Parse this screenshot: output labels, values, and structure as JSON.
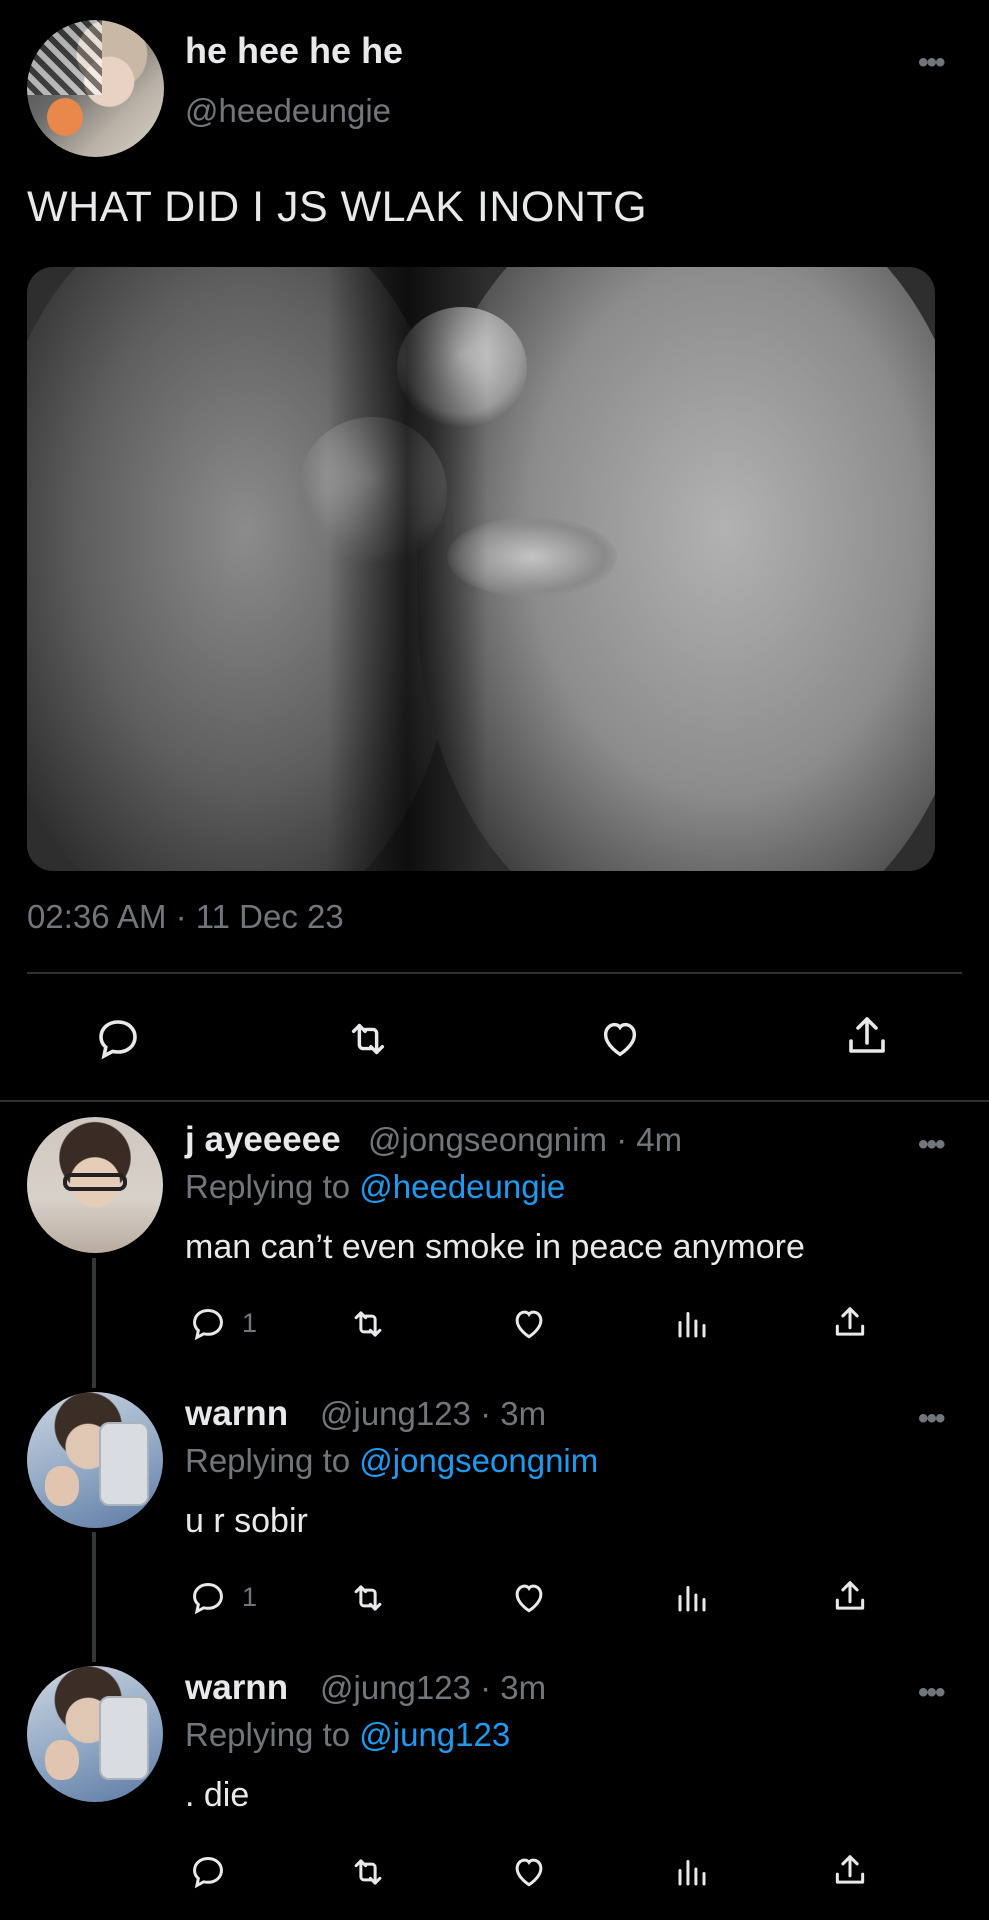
{
  "main_tweet": {
    "display_name": "he hee he he",
    "handle": "@heedeungie",
    "text": "WHAT DID I JS WLAK INONTG",
    "timestamp": "02:36 AM · 11 Dec 23",
    "image_icon": "photo-two-faces-close-up-bw",
    "avatar_icon": "profile-photo-icon"
  },
  "replies": [
    {
      "display_name": "j ayeeeee",
      "handle_time": "@jongseongnim · 4m",
      "replying_prefix": "Replying to ",
      "replying_to": "@heedeungie",
      "text": "man can’t even smoke in peace anymore",
      "reply_count": "1"
    },
    {
      "display_name": "warnn",
      "handle_time": "@jung123 · 3m",
      "replying_prefix": "Replying to ",
      "replying_to": "@jongseongnim",
      "text": "u r sobir",
      "reply_count": "1"
    },
    {
      "display_name": "warnn",
      "handle_time": "@jung123 · 3m",
      "replying_prefix": "Replying to ",
      "replying_to": "@jung123",
      "text": ". die",
      "reply_count": ""
    }
  ],
  "icons": {
    "more": "more-horizontal-icon",
    "reply": "reply-icon",
    "retweet": "retweet-icon",
    "like": "heart-icon",
    "views": "views-icon",
    "share": "share-icon"
  },
  "more_glyph": "•••",
  "colors": {
    "background": "#000000",
    "text": "#e7e9ea",
    "secondary": "#71767b",
    "link": "#1d9bf0",
    "divider": "#2f3336"
  }
}
